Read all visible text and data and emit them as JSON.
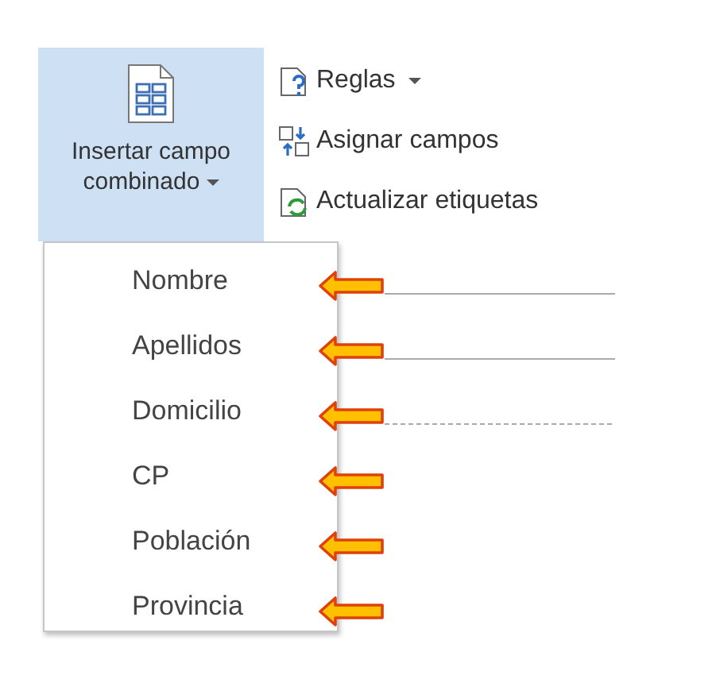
{
  "insert_button": {
    "label_lines": [
      "Insertar campo",
      "combinado"
    ],
    "selected": true,
    "has_dropdown": true
  },
  "commands": [
    {
      "label": "Reglas",
      "kind": "rules",
      "has_dropdown": true
    },
    {
      "label": "Asignar campos",
      "kind": "map",
      "has_dropdown": false
    },
    {
      "label": "Actualizar etiquetas",
      "kind": "update",
      "has_dropdown": false
    }
  ],
  "menu_items": [
    {
      "label": "Nombre",
      "annotated": true,
      "kind": "solid_rule"
    },
    {
      "label": "Apellidos",
      "annotated": true,
      "kind": "solid_rule"
    },
    {
      "label": "Domicilio",
      "annotated": true,
      "kind": "dashed_rule"
    },
    {
      "label": "CP",
      "annotated": true,
      "kind": "plain"
    },
    {
      "label": "Población",
      "annotated": true,
      "kind": "plain"
    },
    {
      "label": "Provincia",
      "annotated": true,
      "kind": "plain"
    }
  ]
}
